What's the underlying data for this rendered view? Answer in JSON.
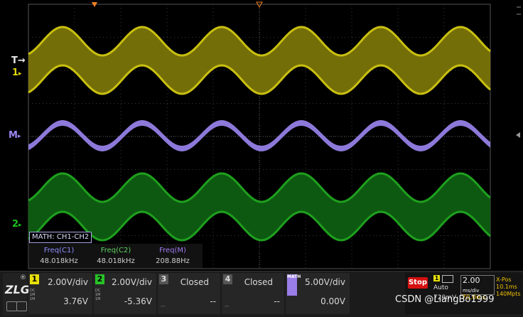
{
  "markers": {
    "trigger_label": "T",
    "ch1_label": "1",
    "math_label": "M",
    "ch2_label": "2"
  },
  "math_box": "MATH: CH1-CH2",
  "measurements": [
    {
      "label": "Freq(C1)",
      "value": "48.018kHz",
      "color": "#8e8eff"
    },
    {
      "label": "Freq(C2)",
      "value": "48.018kHz",
      "color": "#5fcf5f"
    },
    {
      "label": "Freq(M)",
      "value": "208.88Hz",
      "color": "#a07cf0"
    }
  ],
  "channels": [
    {
      "num": "1",
      "badge_color": "#e8e00a",
      "scale": "2.00V/div",
      "offset": "3.76V",
      "coupling": "DC\n1M"
    },
    {
      "num": "2",
      "badge_color": "#27c227",
      "scale": "2.00V/div",
      "offset": "-5.36V",
      "coupling": "DC\n1M"
    },
    {
      "num": "3",
      "badge_color": "#888888",
      "scale": "Closed",
      "offset": "--",
      "coupling": ""
    },
    {
      "num": "4",
      "badge_color": "#888888",
      "scale": "Closed",
      "offset": "--",
      "coupling": ""
    },
    {
      "num": "MATH",
      "badge_color": "#9a7de8",
      "scale": "5.00V/div",
      "offset": "0.00V",
      "coupling": ""
    }
  ],
  "run": {
    "state": "Stop",
    "trig_channel": "1",
    "mode": "Auto",
    "trig_level": "720mV",
    "timebase": "2.00",
    "timebase_unit": "ms/div",
    "delay": "70.0ms",
    "xpos": "X-Pos",
    "xpos_val": "10.1ms",
    "rate": "140Mpts"
  },
  "brand": {
    "logo": "ZLG",
    "reg": "®"
  },
  "watermark": "CSDN @LiangBo1999",
  "colors": {
    "ch1": "#c9c010",
    "ch1_dark": "#7a740a",
    "ch2": "#1ea01e",
    "ch2_dark": "#0f5e12",
    "math": "#9c86f2",
    "trigger": "#f08020",
    "grid": "#3a3a3a"
  }
}
